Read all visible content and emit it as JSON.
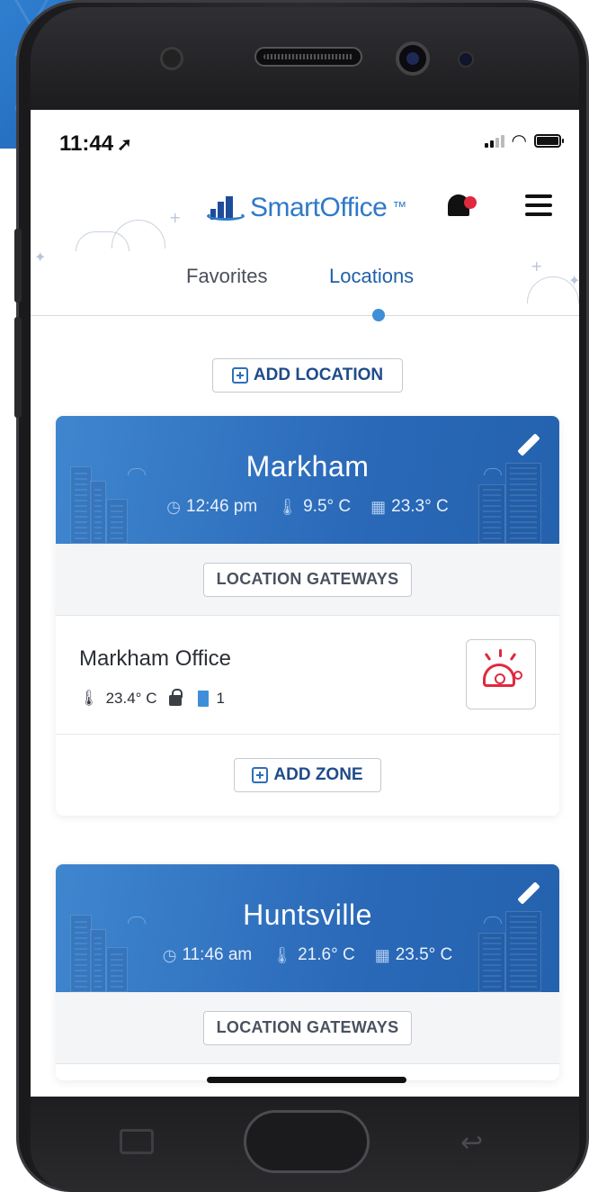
{
  "status_bar": {
    "time": "11:44",
    "location_arrow": "location-arrow-icon",
    "signal": "signal-icon",
    "wifi": "wifi-icon",
    "battery": "battery-icon"
  },
  "header": {
    "brand": "SmartOffice",
    "trademark": "™",
    "notification_icon": "bell-icon",
    "notification_badge_color": "#e0293e",
    "menu_icon": "hamburger-icon"
  },
  "tabs": [
    {
      "label": "Favorites",
      "active": false
    },
    {
      "label": "Locations",
      "active": true
    }
  ],
  "actions": {
    "add_location": "ADD LOCATION"
  },
  "locations": [
    {
      "name": "Markham",
      "time": "12:46 pm",
      "outdoor_temp": "9.5° C",
      "indoor_temp": "23.3° C",
      "gateways_label": "LOCATION GATEWAYS",
      "zones": [
        {
          "name": "Markham Office",
          "temp": "23.4° C",
          "locked": true,
          "doors": "1",
          "alarm_icon": "alarm-bell-icon"
        }
      ],
      "add_zone_label": "ADD ZONE"
    },
    {
      "name": "Huntsville",
      "time": "11:46 am",
      "outdoor_temp": "21.6° C",
      "indoor_temp": "23.5° C",
      "gateways_label": "LOCATION GATEWAYS"
    }
  ],
  "colors": {
    "accent": "#2f79c8",
    "card_header": "#2a69b8",
    "alert": "#e0293e",
    "active_tab": "#1f5fa8"
  }
}
